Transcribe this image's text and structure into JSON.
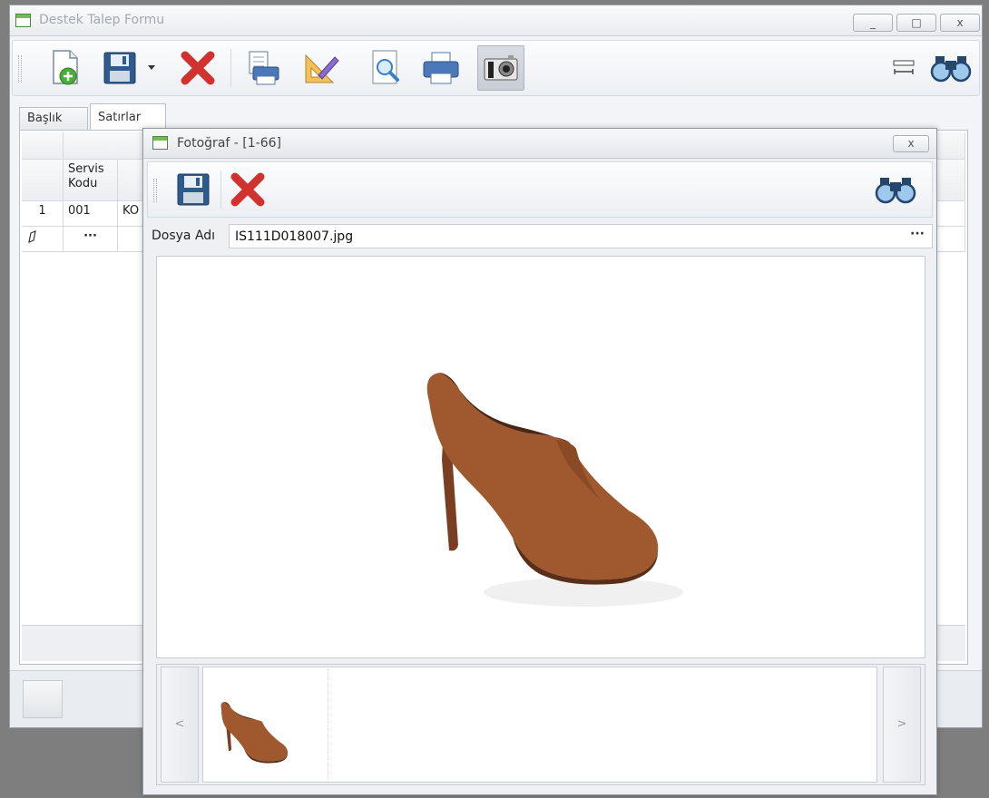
{
  "main_window": {
    "title": "Destek Talep Formu",
    "caption_buttons": [
      "_",
      "□",
      "x"
    ]
  },
  "toolbar": {
    "items": [
      "new-document-icon",
      "save-icon",
      "dropdown-arrow-icon",
      "delete-icon",
      "print-preview-icon",
      "design-icon",
      "zoom-preview-icon",
      "printer-icon",
      "camera-icon",
      "column-width-icon",
      "binoculars-icon"
    ]
  },
  "tabs": {
    "baslik": "Başlık",
    "satirlar": "Satırlar"
  },
  "grid": {
    "header_servis": "Servis\nKodu",
    "rows": [
      {
        "num": "1",
        "servis": "001",
        "next": "KO"
      }
    ],
    "new_row_ellipsis": "···"
  },
  "photo_dialog": {
    "title": "Fotoğraf - [1-66]",
    "close_label": "x",
    "file_label": "Dosya Adı",
    "file_value": "IS111D018007.jpg",
    "browse_label": "···",
    "prev_label": "<",
    "next_label": ">"
  },
  "colors": {
    "shoe": "#a0582e",
    "heel": "#7a3e22",
    "accent_green": "#6bc04a"
  }
}
